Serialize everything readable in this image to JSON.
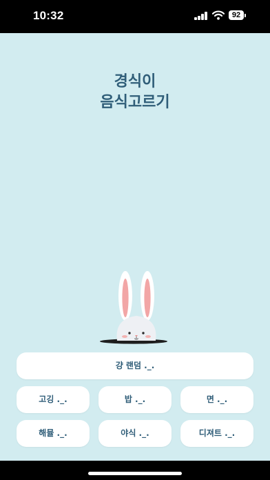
{
  "status_bar": {
    "time": "10:32",
    "battery_level": "92",
    "icons": [
      "signal-icon",
      "wifi-icon",
      "battery-icon"
    ]
  },
  "app": {
    "title_line1": "경식이",
    "title_line2": "음식고르기",
    "background_color": "#d2ecf0",
    "text_color": "#2f5d78"
  },
  "buttons": {
    "random": "걍 랜덤 ._.",
    "meat": "고깅 ._.",
    "rice": "밥 ._.",
    "noodle": "면 ._.",
    "seafood": "해뮬 ._.",
    "latenight": "야식 ._.",
    "dessert": "디져트 ._."
  }
}
